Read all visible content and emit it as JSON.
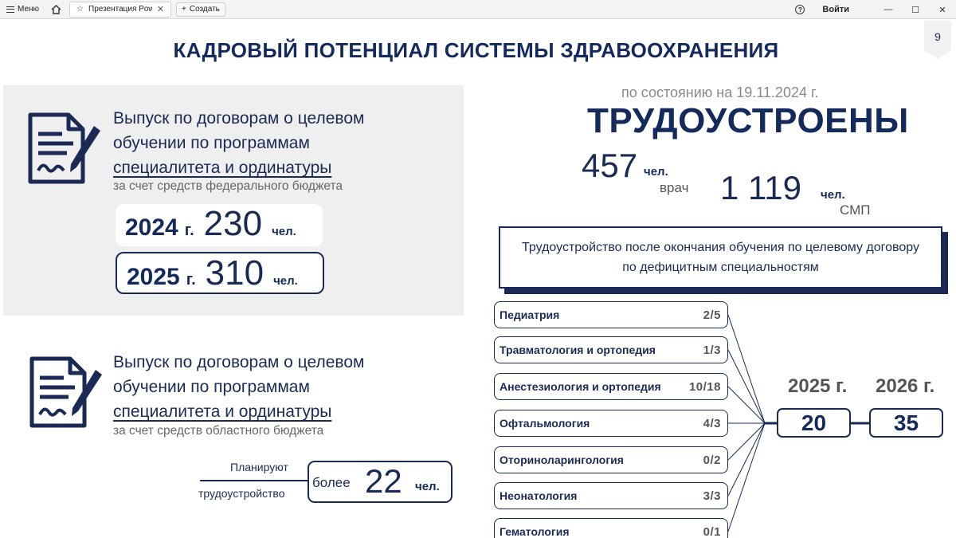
{
  "browser": {
    "menu_label": "Меню",
    "tab_title": "Презентация Power...",
    "new_tab_label": "Создать",
    "login_label": "Войти"
  },
  "slide": {
    "page_number": "9",
    "title": "КАДРОВЫЙ ПОТЕНЦИАЛ СИСТЕМЫ ЗДРАВООХРАНЕНИЯ",
    "federal": {
      "line1": "Выпуск по договорам о целевом",
      "line2": "обучении по программам",
      "line3": "специалитета и ординатуры",
      "subtitle": "за счет средств федерального бюджета",
      "years": [
        {
          "year": "2024",
          "g": "г.",
          "value": "230",
          "unit": "чел."
        },
        {
          "year": "2025",
          "g": "г.",
          "value": "310",
          "unit": "чел."
        }
      ]
    },
    "regional": {
      "line1": "Выпуск по договорам о целевом",
      "line2": "обучении по программам",
      "line3": "специалитета и ординатуры",
      "subtitle": "за счет средств областного бюджета",
      "plan_line1": "Планируют",
      "plan_line2": "трудоустройство",
      "plan_more": "более",
      "plan_value": "22",
      "plan_unit": "чел."
    },
    "employment": {
      "as_of": "по состоянию на 19.11.2024 г.",
      "heading": "ТРУДОУСТРОЕНЫ",
      "doctors_value": "457",
      "doctors_unit": "чел.",
      "doctors_caption": "врач",
      "nurses_value": "1 119",
      "nurses_unit": "чел.",
      "nurses_caption": "СМП"
    },
    "info_box": "Трудоустройство после окончания обучения по целевому договору по дефицитным специальностям",
    "specialties": [
      {
        "name": "Педиатрия",
        "value": "2/5"
      },
      {
        "name": "Травматология и ортопедия",
        "value": "1/3"
      },
      {
        "name": "Анестезиология и ортопедия",
        "value": "10/18"
      },
      {
        "name": "Офтальмология",
        "value": "4/3"
      },
      {
        "name": "Оториноларингология",
        "value": "0/2"
      },
      {
        "name": "Неонатология",
        "value": "3/3"
      },
      {
        "name": "Гематология",
        "value": "0/1"
      }
    ],
    "totals": [
      {
        "year": "2025 г.",
        "value": "20"
      },
      {
        "year": "2026 г.",
        "value": "35"
      }
    ],
    "colors": {
      "primary": "#1b2a55",
      "gray_panel": "#efefef",
      "muted_text": "#666666"
    }
  }
}
